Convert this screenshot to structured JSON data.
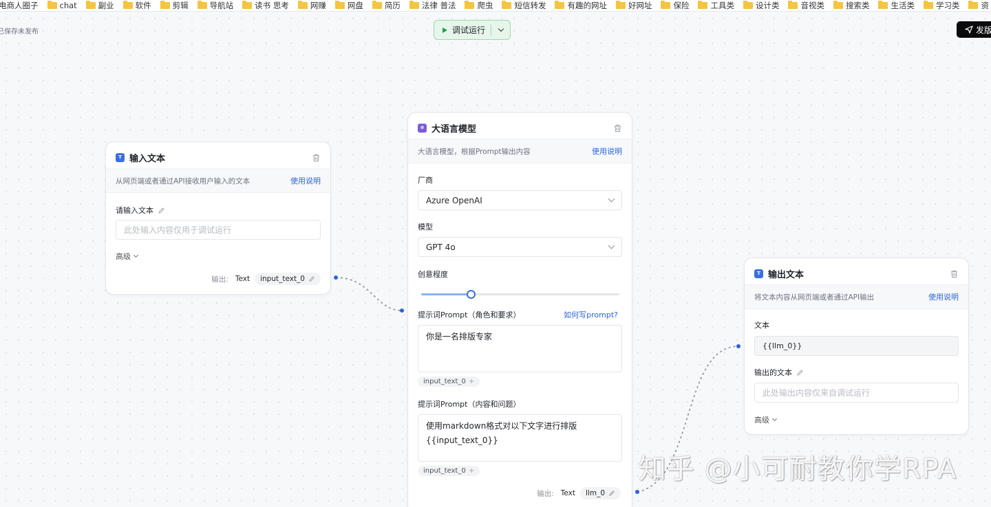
{
  "bookmarks": [
    "电商人圈子",
    "chat",
    "副业",
    "软件",
    "剪辑",
    "导航站",
    "读书 思考",
    "网赚",
    "网盘",
    "简历",
    "法律 普法",
    "爬虫",
    "短信转发",
    "有趣的网址",
    "好网址",
    "保险",
    "工具类",
    "设计类",
    "音视类",
    "搜索类",
    "生活类",
    "学习类",
    "资"
  ],
  "toolbar": {
    "save_status": "已保存未发布",
    "run_label": "调试运行",
    "publish_label": "发版"
  },
  "input_node": {
    "title": "输入文本",
    "description": "从网页端或者通过API接收用户输入的文本",
    "help": "使用说明",
    "field_label": "请输入文本",
    "placeholder": "此处输入内容仅用于调试运行",
    "advanced": "高级",
    "output_label": "输出:",
    "output_type": "Text",
    "output_var": "input_text_0"
  },
  "llm_node": {
    "title": "大语言模型",
    "description": "大语言模型，根据Prompt输出内容",
    "help": "使用说明",
    "vendor_label": "厂商",
    "vendor_value": "Azure OpenAI",
    "model_label": "模型",
    "model_value": "GPT 4o",
    "creativity_label": "创意程度",
    "creativity_value": 0.25,
    "system_prompt_label": "提示词Prompt（角色和要求）",
    "prompt_help": "如何写prompt?",
    "system_prompt": "你是一名排版专家",
    "system_chip": "input_text_0",
    "user_prompt_label": "提示词Prompt（内容和问题）",
    "user_prompt_line1": "使用markdown格式对以下文字进行排版",
    "user_prompt_line2": "{{input_text_0}}",
    "user_chip": "input_text_0",
    "output_label": "输出:",
    "output_type": "Text",
    "output_var": "llm_0"
  },
  "output_node": {
    "title": "输出文本",
    "description": "将文本内容从网页端或者通过API输出",
    "help": "使用说明",
    "text_label": "文本",
    "text_value": "{{llm_0}}",
    "output_text_label": "输出的文本",
    "placeholder": "此处输出内容仅来自调试运行",
    "advanced": "高级"
  },
  "watermark": "知乎 @小可耐教你学RPA",
  "colors": {
    "accent": "#2a64e0",
    "run_bg": "#e6f6ea",
    "run_play": "#1e9e4a",
    "publish_bg": "#0b0b0c"
  }
}
